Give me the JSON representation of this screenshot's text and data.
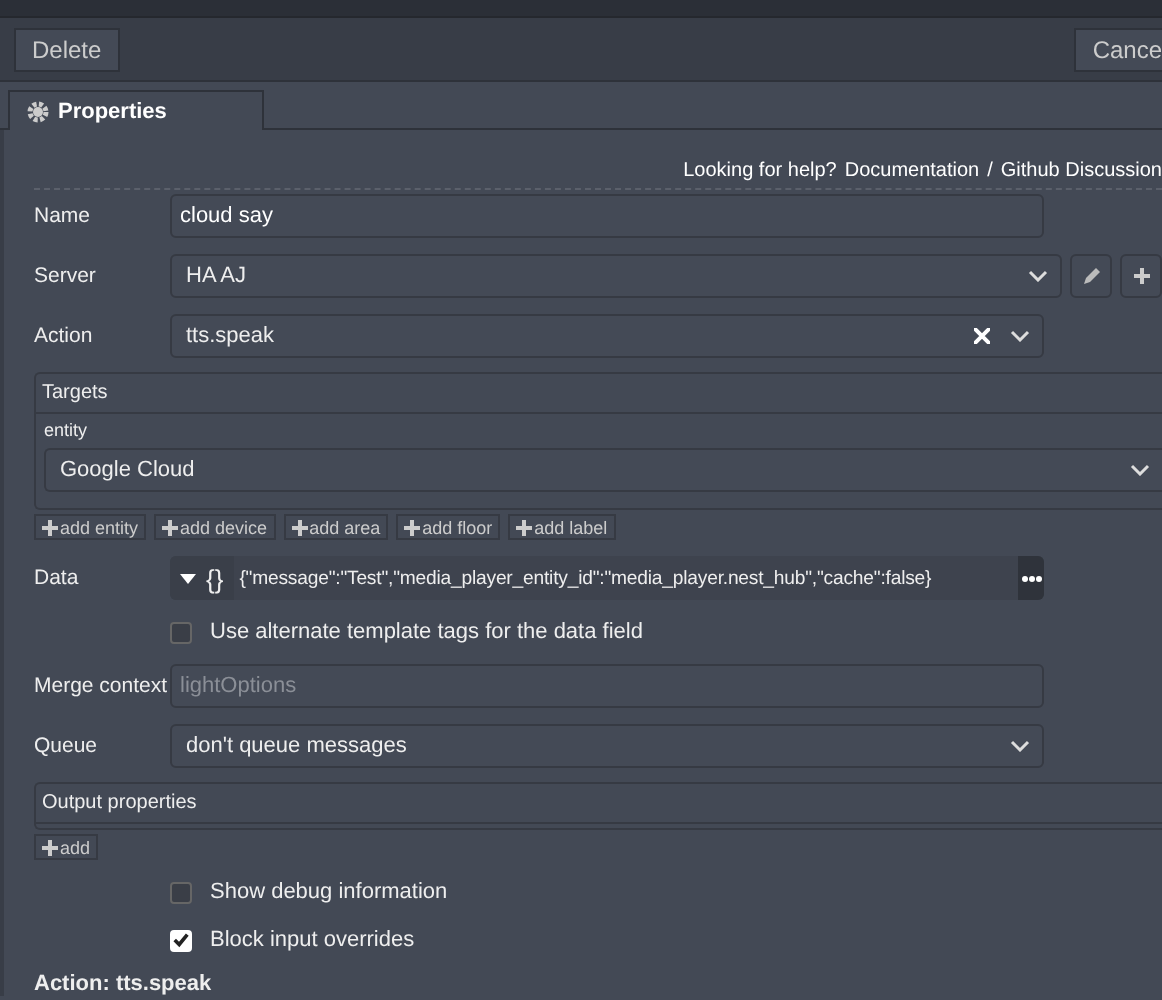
{
  "toolbar": {
    "delete_button": "Delete",
    "cancel_button": "Cance"
  },
  "tabs": [
    {
      "label": "Properties",
      "selected": true
    }
  ],
  "help": {
    "prompt": "Looking for help?",
    "links": [
      "Documentation",
      "Github Discussion"
    ],
    "separator": "/"
  },
  "form": [
    {
      "kind": "text",
      "label": "Name",
      "value": "cloud say"
    },
    {
      "kind": "server",
      "label": "Server",
      "value": "HA AJ"
    },
    {
      "kind": "combo",
      "label": "Action",
      "value": "tts.speak"
    },
    {
      "kind": "targets",
      "title": "Targets",
      "entity_label": "entity",
      "entity_value": "Google Cloud",
      "add_buttons": [
        "add entity",
        "add device",
        "add area",
        "add floor",
        "add label"
      ]
    },
    {
      "kind": "data",
      "label": "Data",
      "type_label": "{}",
      "value": "{\"message\":\"Test\",\"media_player_entity_id\":\"media_player.nest_hub\",\"cache\":false}"
    },
    {
      "kind": "checkbox",
      "label": "Use alternate template tags for the data field",
      "checked": false
    },
    {
      "kind": "text",
      "label": "Merge context",
      "placeholder": "lightOptions"
    },
    {
      "kind": "select",
      "label": "Queue",
      "value": "don't queue messages"
    },
    {
      "kind": "output",
      "title": "Output properties",
      "add_button": "add"
    },
    {
      "kind": "checkbox",
      "label": "Show debug information",
      "checked": false
    },
    {
      "kind": "checkbox",
      "label": "Block input overrides",
      "checked": true
    }
  ],
  "section_title": "Action: tts.speak"
}
